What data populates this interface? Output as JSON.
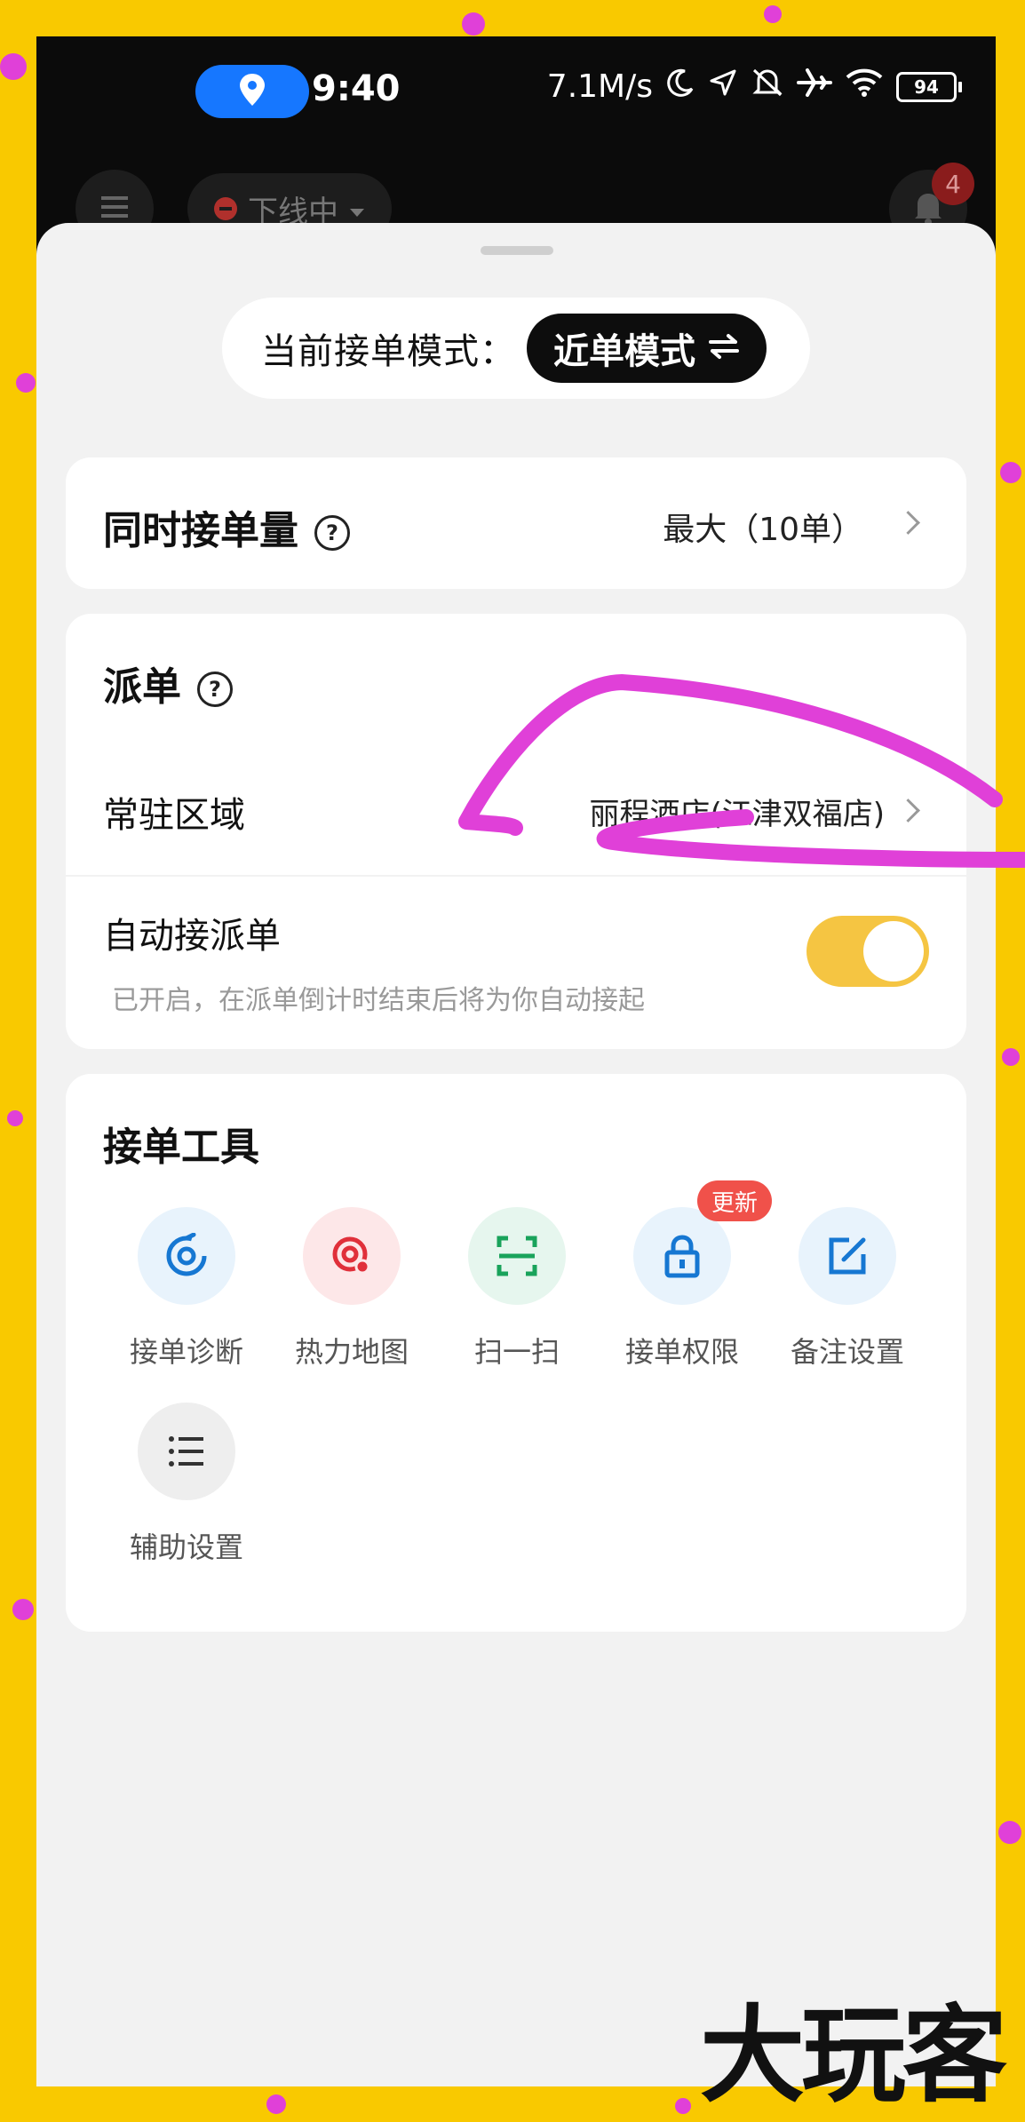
{
  "status_bar": {
    "time": "9:40",
    "net_speed": "7.1M/s",
    "battery": "94",
    "icons": [
      "location-icon",
      "moon-icon",
      "navigation-icon",
      "mute-icon",
      "airplane-icon",
      "wifi-icon"
    ]
  },
  "top_bar": {
    "status": "下线中",
    "notification_count": "4"
  },
  "mode": {
    "label": "当前接单模式：",
    "value": "近单模式"
  },
  "concurrent": {
    "title": "同时接单量",
    "value": "最大（10单）"
  },
  "dispatch": {
    "title": "派单",
    "area_label": "常驻区域",
    "area_value": "丽程酒店(江津双福店)",
    "auto_label": "自动接派单",
    "auto_hint": "已开启，在派单倒计时结束后将为你自动接起",
    "auto_on": true
  },
  "tools": {
    "title": "接单工具",
    "items": [
      {
        "label": "接单诊断",
        "icon": "diagnosis-icon",
        "color": "#1677d2",
        "bg": "#e8f3fc"
      },
      {
        "label": "热力地图",
        "icon": "heatmap-icon",
        "color": "#e0303a",
        "bg": "#fde7e8"
      },
      {
        "label": "扫一扫",
        "icon": "scan-icon",
        "color": "#19a35b",
        "bg": "#e6f6ee"
      },
      {
        "label": "接单权限",
        "icon": "lock-icon",
        "color": "#1677d2",
        "bg": "#e8f3fc",
        "badge": "更新"
      },
      {
        "label": "备注设置",
        "icon": "edit-icon",
        "color": "#1677d2",
        "bg": "#e8f3fc"
      },
      {
        "label": "辅助设置",
        "icon": "list-icon",
        "color": "#333333",
        "bg": "#eeeeee"
      }
    ]
  },
  "colors": {
    "accent_toggle": "#f5c542",
    "annotation": "#e040d8",
    "frame": "#f9c900"
  },
  "watermark": "大玩客"
}
